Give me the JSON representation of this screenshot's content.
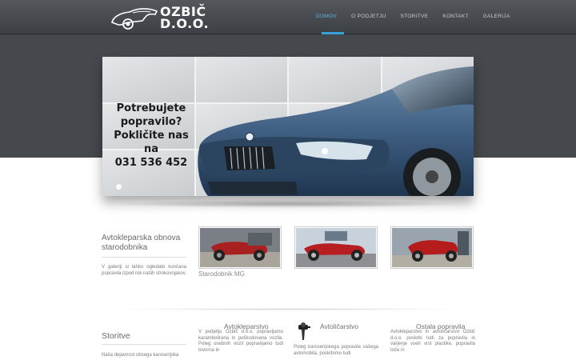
{
  "brand": {
    "line1": "OZBIČ",
    "line2": "D.O.O."
  },
  "nav": [
    {
      "label": "DOMOV",
      "active": true
    },
    {
      "label": "O PODJETJU",
      "active": false
    },
    {
      "label": "STORITVE",
      "active": false
    },
    {
      "label": "KONTAKT",
      "active": false
    },
    {
      "label": "GALERIJA",
      "active": false
    }
  ],
  "hero": {
    "line1": "Potrebujete",
    "line2": "popravilo?",
    "line3": "Pokličite nas na",
    "line4": "031 536 452"
  },
  "oldtimers": {
    "title": "Avtokleparska obnova starodobnika",
    "text": "V galeriji si lahko ogledate končana popravila izpod rok naših strokovnjakov.",
    "caption": "Starodobnik MG"
  },
  "services": {
    "title": "Storitve",
    "text": "Naša dejavnost obsega karoserijska"
  },
  "columns": [
    {
      "title": "Avtokleparstvo",
      "text": "V podjetju Ozbič d.o.o. popravljamo karambolirana in poškodovana vozila. Poleg osebnih vozil popravljamo tudi tovorna in"
    },
    {
      "title": "Avtoličarstvo",
      "text": "Poleg karoserijskega popravila vašega avtomobila, poskrbimo tudi"
    },
    {
      "title": "Ostala popravila",
      "text": "Avtokleparstvo in avtoličarstvo Ozbič d.o.o. poskrbi tudi za popravila in varjenje vseh vrst plastike, popravila toče in"
    }
  ],
  "colors": {
    "accent": "#3aa0d8",
    "header": "#45484d"
  }
}
